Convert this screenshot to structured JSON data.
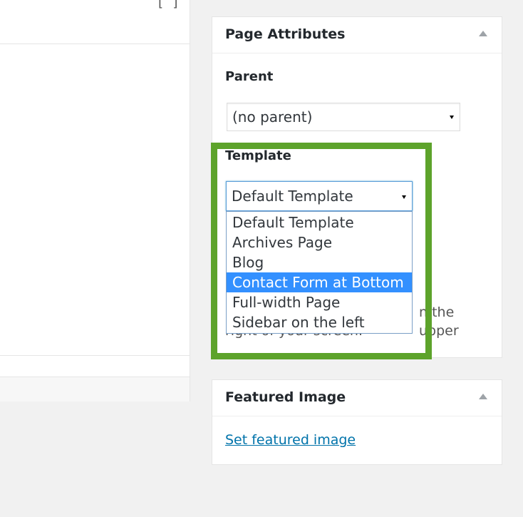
{
  "colors": {
    "background": "#f1f1f1",
    "highlight_frame": "#5da32b",
    "link": "#0073aa",
    "selected_option": "#3390ff"
  },
  "page_attributes": {
    "title": "Page Attributes",
    "parent_label": "Parent",
    "parent_value": "(no parent)",
    "template_label": "Template",
    "template_value": "Default Template",
    "template_options": [
      "Default Template",
      "Archives Page",
      "Blog",
      "Contact Form at Bottom",
      "Full-width Page",
      "Sidebar on the left"
    ],
    "highlighted_option": "Contact Form at Bottom",
    "help_text_visible_right": "n the upper",
    "help_text_visible_line2": "right of your screen."
  },
  "featured_image": {
    "title": "Featured Image",
    "link_label": "Set featured image"
  },
  "icons": {
    "collapse_toggle": "triangle-up-icon",
    "select_caret": "caret-down-icon"
  }
}
